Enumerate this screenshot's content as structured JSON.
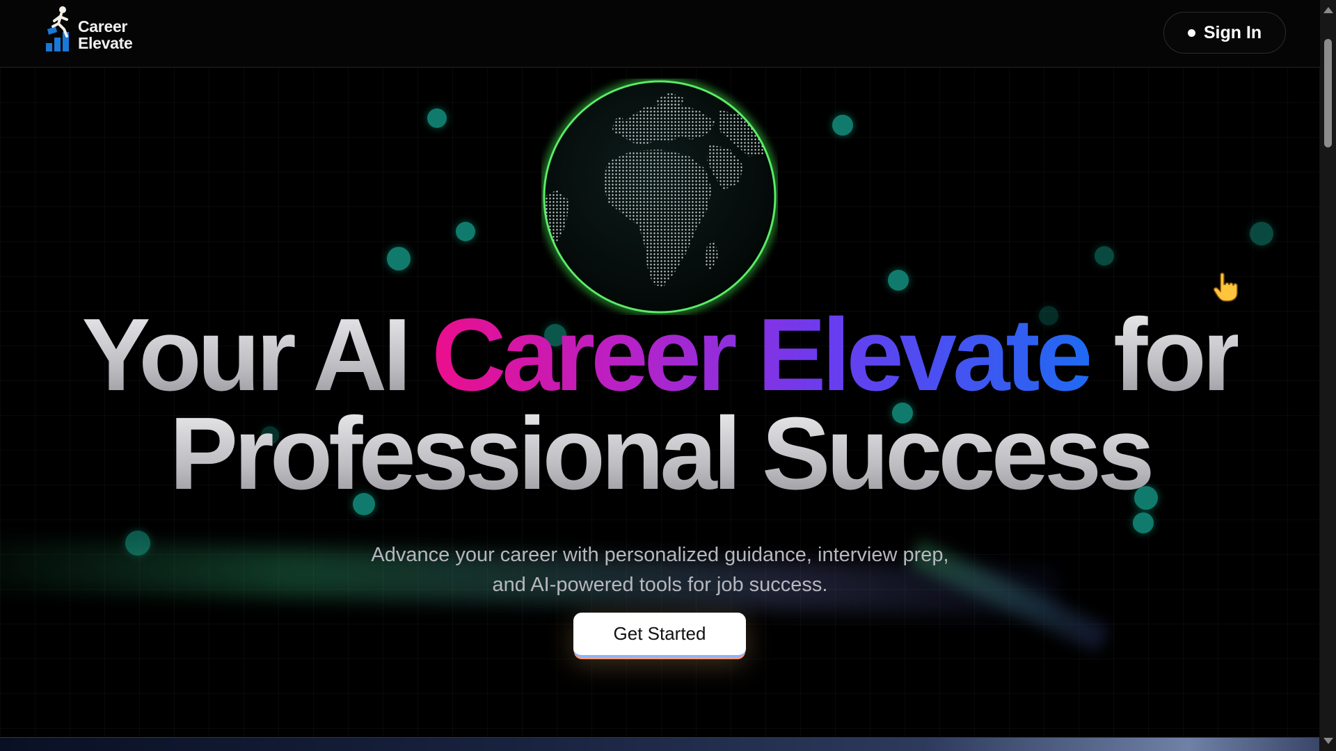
{
  "app": {
    "logo_line1": "Career",
    "logo_line2": "Elevate",
    "logo_icon": "person-climbing-bars-icon"
  },
  "header": {
    "signin_label": "Sign In",
    "signin_icon": "dot-icon"
  },
  "hero": {
    "headline_part1": "Your AI",
    "headline_highlight": "Career Elevate",
    "headline_part2": "for",
    "headline_line2": "Professional Success",
    "subtitle": "Advance your career with personalized guidance, interview prep, and AI-powered tools for job success.",
    "cta_label": "Get Started",
    "globe_icon": "globe-icon",
    "cursor_icon": "pointing-hand-cursor-icon"
  },
  "colors": {
    "background": "#000000",
    "gradient_start": "#ec0e8c",
    "gradient_mid": "#6a3cf0",
    "gradient_end": "#1f6af2",
    "globe_glow": "#3fd44a",
    "dots": "#13917f"
  }
}
